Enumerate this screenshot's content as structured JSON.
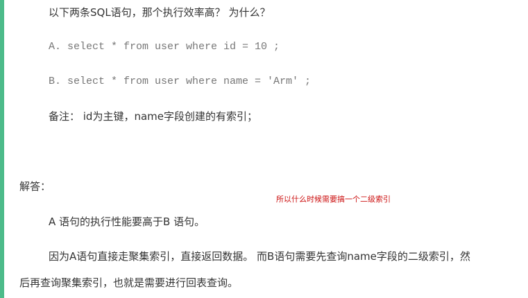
{
  "question": "以下两条SQL语句，那个执行效率高？ 为什么？",
  "option_a": "A. select * from user where id = 10 ;",
  "option_b": "B. select * from user where name = 'Arm' ;",
  "remark": "备注： id为主键，name字段创建的有索引；",
  "answer_heading": "解答：",
  "annotation": "所以什么时候需要搞一个二级索引",
  "answer_line1": "A 语句的执行性能要高于B 语句。",
  "answer_line2": "因为A语句直接走聚集索引，直接返回数据。 而B语句需要先查询name字段的二级索引，然",
  "answer_line3": "后再查询聚集索引，也就是需要进行回表查询。",
  "colors": {
    "left_border": "#4dbb8a",
    "text": "#333333",
    "code_text": "#777777",
    "annotation": "#cc1111"
  }
}
